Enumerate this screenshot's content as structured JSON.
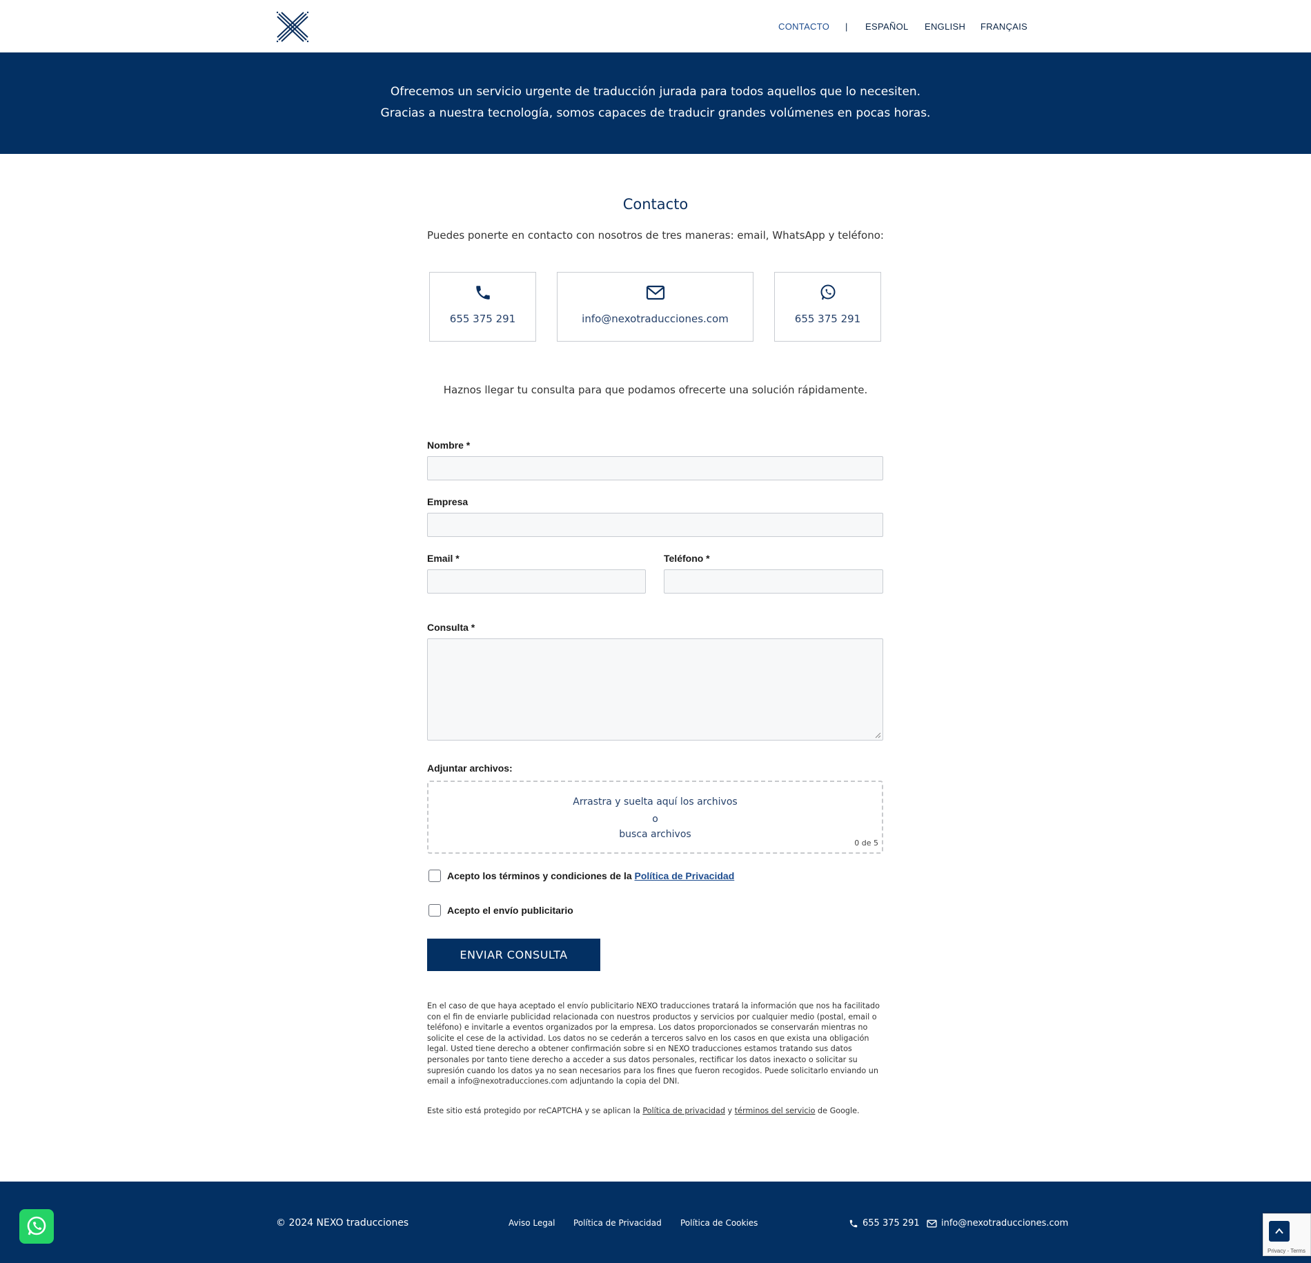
{
  "header": {
    "logo_name": "nexo-x-logo",
    "nav": [
      {
        "label": "CONTACTO"
      },
      {
        "label": "ESPAÑOL"
      },
      {
        "label": "ENGLISH"
      },
      {
        "label": "FRANÇAIS"
      }
    ],
    "separator": "|"
  },
  "hero": {
    "line1": "Ofrecemos un servicio urgente de traducción jurada para todos aquellos que lo necesiten.",
    "line2": "Gracias a nuestra tecnología, somos capaces de traducir grandes volúmenes en pocas horas."
  },
  "contact": {
    "title": "Contacto",
    "intro": "Puedes ponerte en contacto con nosotros de tres maneras: email, WhatsApp y teléfono:",
    "cards": [
      {
        "icon": "phone-icon",
        "text": "655 375 291"
      },
      {
        "icon": "mail-icon",
        "text": "info@nexotraducciones.com"
      },
      {
        "icon": "whatsapp-icon",
        "text": "655 375 291"
      }
    ],
    "cta": "Haznos llegar tu consulta para que podamos ofrecerte una solución rápidamente."
  },
  "form": {
    "nombre_label": "Nombre *",
    "empresa_label": "Empresa",
    "email_label": "Email *",
    "telefono_label": "Teléfono *",
    "consulta_label": "Consulta *",
    "adjuntar_label": "Adjuntar archivos:",
    "drop_text": "Arrastra y suelta aquí los archivos",
    "drop_or": "o",
    "drop_browse": "busca archivos",
    "drop_count": "0 de 5",
    "terms_label": "Acepto los términos y condiciones de la ",
    "terms_link": "Política de Privacidad",
    "ads_label": "Acepto el envío publicitario",
    "submit": "ENVIAR CONSULTA"
  },
  "legal": {
    "text": "En el caso de que haya aceptado el envío publicitario NEXO traducciones tratará la información que nos ha facilitado con el fin de enviarle publicidad relacionada con nuestros productos y servicios por cualquier medio (postal, email o teléfono) e invitarle a eventos organizados por la empresa. Los datos proporcionados se conservarán mientras no solicite el cese de la actividad. Los datos no se cederán a terceros salvo en los casos en que exista una obligación legal. Usted tiene derecho a obtener confirmación sobre si en NEXO traducciones estamos tratando sus datos personales por tanto tiene derecho a acceder a sus datos personales, rectificar los datos inexacto o solicitar su supresión cuando los datos ya no sean necesarios para los fines que fueron recogidos. Puede solicitarlo enviando un email a info@nexotraducciones.com adjuntando la copia del DNI.",
    "recaptcha_pre": "Este sitio está protegido por reCAPTCHA y se aplican la ",
    "recaptcha_privacy": "Política de privacidad",
    "recaptcha_and": " y ",
    "recaptcha_terms": "términos del servicio",
    "recaptcha_post": " de Google."
  },
  "footer": {
    "copyright": "© 2024 NEXO traducciones",
    "links": [
      "Aviso Legal",
      "Política de Privacidad",
      "Política de Cookies"
    ],
    "phone": "655 375 291",
    "email": "info@nexotraducciones.com",
    "recaptcha_badge": "Privacy - Terms"
  },
  "colors": {
    "brand_navy": "#033063",
    "whatsapp_green": "#25d366"
  }
}
